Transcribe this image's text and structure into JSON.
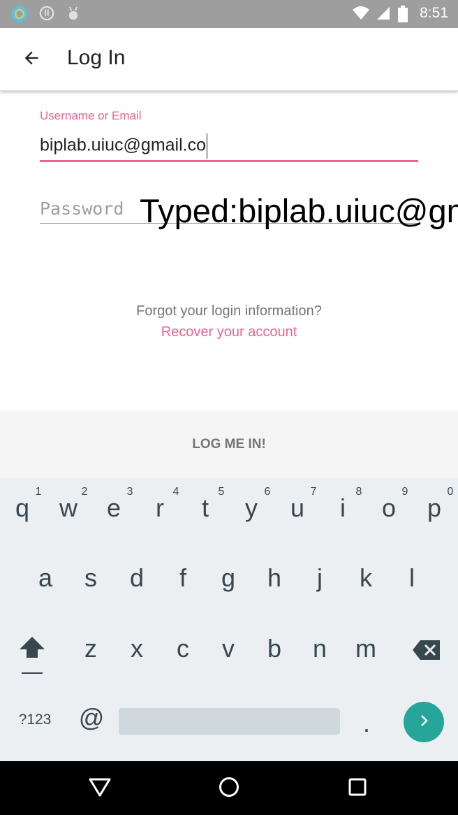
{
  "status_bar": {
    "time": "8:51",
    "left_icons": [
      "ring-app-icon",
      "download-status-icon",
      "android-debug-icon"
    ],
    "right_icons": [
      "wifi-icon",
      "cellular-signal-icon",
      "battery-icon"
    ]
  },
  "app_bar": {
    "title": "Log In",
    "back_icon": "arrow-back-icon"
  },
  "form": {
    "username_label": "Username or Email",
    "username_value": "biplab.uiuc@gmail.co",
    "password_placeholder": "Password",
    "typed_overlay": "Typed:biplab.uiuc@gmail.co",
    "accent_color": "#f06292"
  },
  "recovery": {
    "prompt": "Forgot your login information?",
    "link": "Recover your account"
  },
  "login_button": {
    "label": "LOG ME IN!"
  },
  "keyboard": {
    "row1": [
      {
        "letter": "q",
        "digit": "1"
      },
      {
        "letter": "w",
        "digit": "2"
      },
      {
        "letter": "e",
        "digit": "3"
      },
      {
        "letter": "r",
        "digit": "4"
      },
      {
        "letter": "t",
        "digit": "5"
      },
      {
        "letter": "y",
        "digit": "6"
      },
      {
        "letter": "u",
        "digit": "7"
      },
      {
        "letter": "i",
        "digit": "8"
      },
      {
        "letter": "o",
        "digit": "9"
      },
      {
        "letter": "p",
        "digit": "0"
      }
    ],
    "row2": [
      "a",
      "s",
      "d",
      "f",
      "g",
      "h",
      "j",
      "k",
      "l"
    ],
    "row3": [
      "z",
      "x",
      "c",
      "v",
      "b",
      "n",
      "m"
    ],
    "symbols_label": "?123",
    "at_label": "@",
    "period_label": ".",
    "go_color": "#26a69a"
  },
  "nav_bar": {
    "icons": [
      "back-triangle-icon",
      "home-circle-icon",
      "recents-square-icon"
    ]
  }
}
